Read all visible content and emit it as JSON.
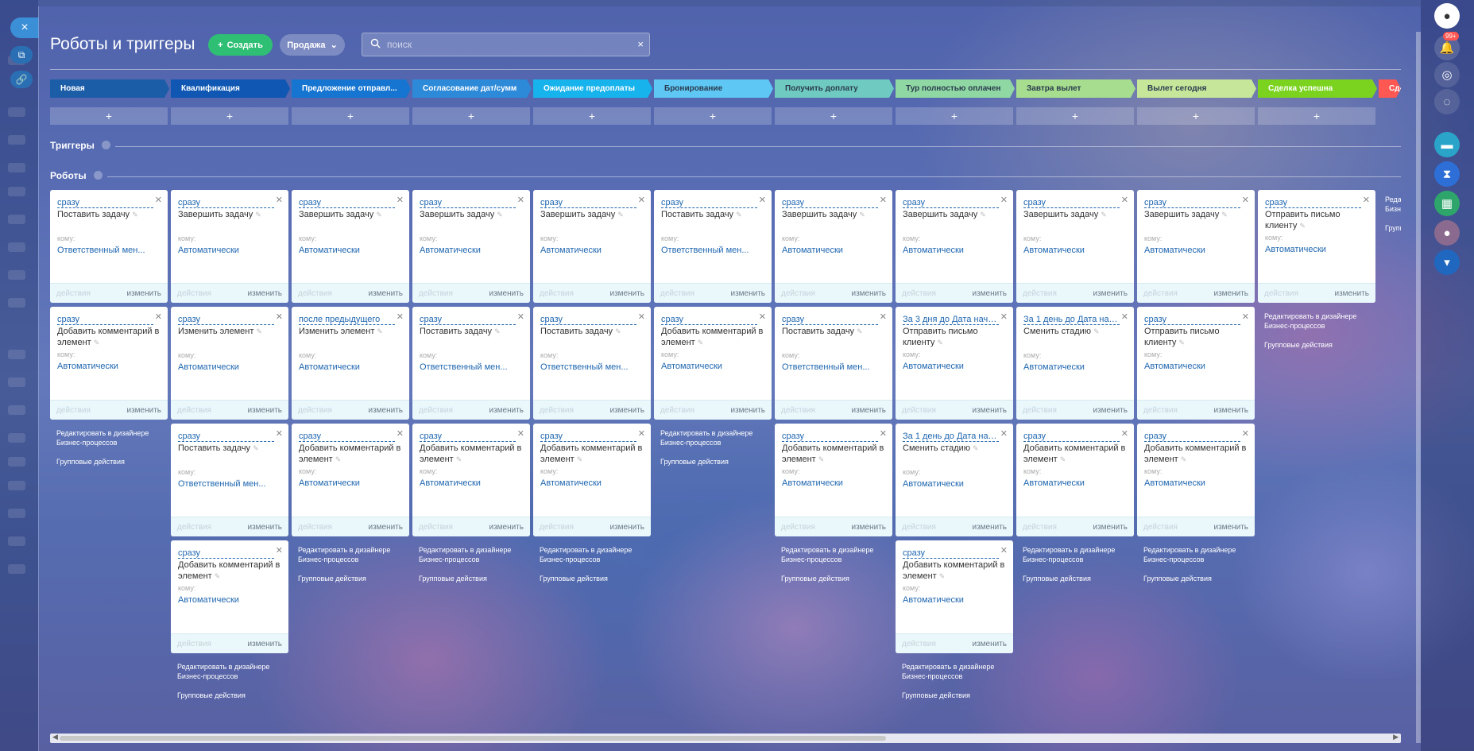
{
  "page": {
    "title": "Роботы и триггеры",
    "create_label": "Создать",
    "sale_label": "Продажа",
    "search_placeholder": "поиск"
  },
  "sections": {
    "triggers": "Триггеры",
    "robots": "Роботы"
  },
  "left_bar": {
    "close": "×"
  },
  "right_bar": {
    "bell_badge": "99+"
  },
  "links": {
    "edit_bp": "Редактировать в дизайнере Бизнес-процессов",
    "group": "Групповые действия"
  },
  "labels": {
    "to": "кому:",
    "actions": "действия",
    "edit": "изменить",
    "plus": "+"
  },
  "stages": [
    {
      "name": "Новая",
      "color": "#1c5da7",
      "text": "#ffffff"
    },
    {
      "name": "Квалификация",
      "color": "#0f57b2",
      "text": "#ffffff"
    },
    {
      "name": "Предложение отправл...",
      "color": "#1575d1",
      "text": "#ffffff"
    },
    {
      "name": "Согласование дат/сумм",
      "color": "#2d8ad9",
      "text": "#ffffff"
    },
    {
      "name": "Ожидание предоплаты",
      "color": "#17b3ec",
      "text": "#ffffff"
    },
    {
      "name": "Бронирование",
      "color": "#5fc7f3",
      "text": "#2b3b4f"
    },
    {
      "name": "Получить доплату",
      "color": "#6fcbc1",
      "text": "#2b3b4f"
    },
    {
      "name": "Тур полностью оплачен",
      "color": "#8fd8a3",
      "text": "#2b3b4f"
    },
    {
      "name": "Завтра вылет",
      "color": "#a6dd8e",
      "text": "#2b3b4f"
    },
    {
      "name": "Вылет сегодня",
      "color": "#c6e69a",
      "text": "#2b3b4f"
    },
    {
      "name": "Сделка успешна",
      "color": "#7bd320",
      "text": "#ffffff"
    },
    {
      "name": "Сде",
      "color": "#ff5752",
      "text": "#ffffff"
    }
  ],
  "columns": [
    {
      "robots": [
        {
          "cond": "сразу",
          "name": "Поставить задачу",
          "to": "Ответственный мен..."
        },
        {
          "cond": "сразу",
          "name": "Добавить комментарий в элемент",
          "to": "Автоматически"
        }
      ]
    },
    {
      "robots": [
        {
          "cond": "сразу",
          "name": "Завершить задачу",
          "to": "Автоматически"
        },
        {
          "cond": "сразу",
          "name": "Изменить элемент",
          "to": "Автоматически"
        },
        {
          "cond": "сразу",
          "name": "Поставить задачу",
          "to": "Ответственный мен..."
        },
        {
          "cond": "сразу",
          "name": "Добавить комментарий в элемент",
          "to": "Автоматически"
        }
      ]
    },
    {
      "robots": [
        {
          "cond": "сразу",
          "name": "Завершить задачу",
          "to": "Автоматически"
        },
        {
          "cond": "после предыдущего",
          "name": "Изменить элемент",
          "to": "Автоматически"
        },
        {
          "cond": "сразу",
          "name": "Добавить комментарий в элемент",
          "to": "Автоматически"
        }
      ]
    },
    {
      "robots": [
        {
          "cond": "сразу",
          "name": "Завершить задачу",
          "to": "Автоматически"
        },
        {
          "cond": "сразу",
          "name": "Поставить задачу",
          "to": "Ответственный мен..."
        },
        {
          "cond": "сразу",
          "name": "Добавить комментарий в элемент",
          "to": "Автоматически"
        }
      ]
    },
    {
      "robots": [
        {
          "cond": "сразу",
          "name": "Завершить задачу",
          "to": "Автоматически"
        },
        {
          "cond": "сразу",
          "name": "Поставить задачу",
          "to": "Ответственный мен..."
        },
        {
          "cond": "сразу",
          "name": "Добавить комментарий в элемент",
          "to": "Автоматически"
        }
      ]
    },
    {
      "robots": [
        {
          "cond": "сразу",
          "name": "Поставить задачу",
          "to": "Ответственный мен..."
        },
        {
          "cond": "сразу",
          "name": "Добавить комментарий в элемент",
          "to": "Автоматически"
        }
      ]
    },
    {
      "robots": [
        {
          "cond": "сразу",
          "name": "Завершить задачу",
          "to": "Автоматически"
        },
        {
          "cond": "сразу",
          "name": "Поставить задачу",
          "to": "Ответственный мен..."
        },
        {
          "cond": "сразу",
          "name": "Добавить комментарий в элемент",
          "to": "Автоматически"
        }
      ]
    },
    {
      "robots": [
        {
          "cond": "сразу",
          "name": "Завершить задачу",
          "to": "Автоматически"
        },
        {
          "cond": "За 3 дня до Дата нача...",
          "name": "Отправить письмо клиенту",
          "to": "Автоматически"
        },
        {
          "cond": "За 1 день до Дата нач...",
          "name": "Сменить стадию",
          "to": "Автоматически"
        },
        {
          "cond": "сразу",
          "name": "Добавить комментарий в элемент",
          "to": "Автоматически"
        }
      ]
    },
    {
      "robots": [
        {
          "cond": "сразу",
          "name": "Завершить задачу",
          "to": "Автоматически"
        },
        {
          "cond": "За 1 день до Дата нач...",
          "name": "Сменить стадию",
          "to": "Автоматически"
        },
        {
          "cond": "сразу",
          "name": "Добавить комментарий в элемент",
          "to": "Автоматически"
        }
      ]
    },
    {
      "robots": [
        {
          "cond": "сразу",
          "name": "Завершить задачу",
          "to": "Автоматически"
        },
        {
          "cond": "сразу",
          "name": "Отправить письмо клиенту",
          "to": "Автоматически"
        },
        {
          "cond": "сразу",
          "name": "Добавить комментарий в элемент",
          "to": "Автоматически"
        }
      ]
    },
    {
      "robots": [
        {
          "cond": "сразу",
          "name": "Отправить письмо клиенту",
          "to": "Автоматически"
        }
      ]
    }
  ],
  "partial_col": {
    "l1": "Редакт",
    "l2": "Бизнес",
    "l3": "Групп"
  }
}
